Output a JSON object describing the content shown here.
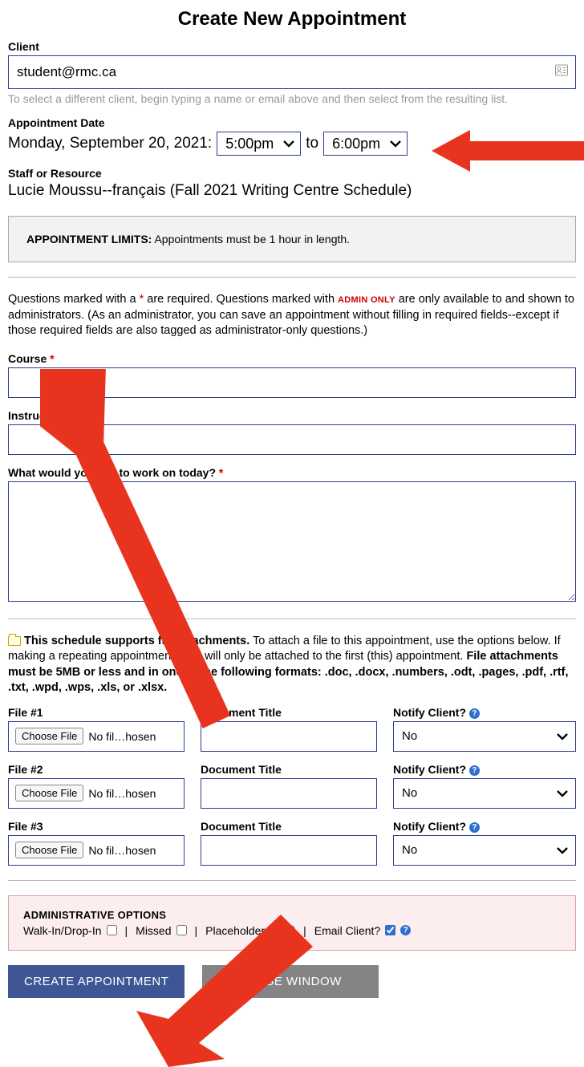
{
  "title": "Create New Appointment",
  "client": {
    "label": "Client",
    "value": "student@rmc.ca",
    "hint": "To select a different client, begin typing a name or email above and then select from the resulting list."
  },
  "date": {
    "label": "Appointment Date",
    "text": "Monday, September 20, 2021:",
    "start": "5:00pm",
    "to": "to",
    "end": "6:00pm"
  },
  "staff": {
    "label": "Staff or Resource",
    "value": "Lucie Moussu--français (Fall 2021 Writing Centre Schedule)"
  },
  "limits": {
    "title": "APPOINTMENT LIMITS:",
    "text": "Appointments must be 1 hour in length."
  },
  "instructions": {
    "p1a": "Questions marked with a ",
    "p1b": " are required. Questions marked with ",
    "admin_only": "ADMIN ONLY",
    "p1c": " are only available to and shown to administrators. (As an administrator, you can save an appointment without filling in required fields--except if those required fields are also tagged as administrator-only questions.)"
  },
  "fields": {
    "course_label": "Course",
    "instructor_label": "Instructor",
    "work_label": "What would you like to work on today?"
  },
  "attachments": {
    "intro_bold1": "This schedule supports file attachments.",
    "intro_text": " To attach a file to this appointment, use the options below. If making a repeating appointment, files will only be attached to the first (this) appointment. ",
    "intro_bold2": "File attachments must be 5MB or less and in one of the following formats: .doc, .docx, .numbers, .odt, .pages, .pdf, .rtf, .txt, .wpd, .wps, .xls, or .xlsx.",
    "doc_title_label": "Document Title",
    "notify_label": "Notify Client?",
    "choose_label": "Choose File",
    "no_file": "No fil…hosen",
    "notify_value": "No",
    "rows": [
      {
        "label": "File #1"
      },
      {
        "label": "File #2"
      },
      {
        "label": "File #3"
      }
    ]
  },
  "admin": {
    "title": "ADMINISTRATIVE OPTIONS",
    "walkin": "Walk-In/Drop-In",
    "missed": "Missed",
    "placeholder": "Placeholder",
    "email": "Email Client?",
    "email_checked": true
  },
  "buttons": {
    "create": "CREATE APPOINTMENT",
    "close": "CLOSE WINDOW"
  }
}
